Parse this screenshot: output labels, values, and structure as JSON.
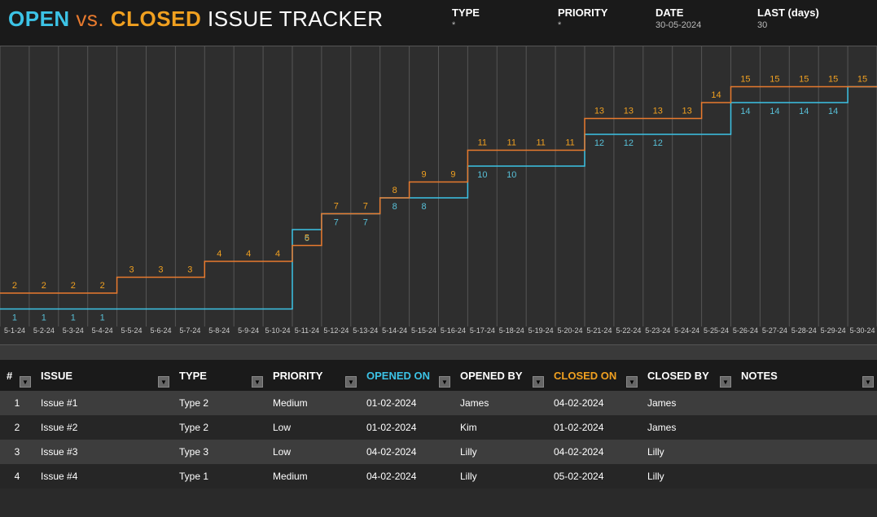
{
  "title": {
    "open": "OPEN",
    "vs": "vs.",
    "closed": "CLOSED",
    "rest": "ISSUE TRACKER"
  },
  "filters": {
    "type": {
      "label": "TYPE",
      "value": "*"
    },
    "prio": {
      "label": "PRIORITY",
      "value": "*"
    },
    "date": {
      "label": "DATE",
      "value": "30-05-2024"
    },
    "last": {
      "label": "LAST (days)",
      "value": "30"
    }
  },
  "columns": {
    "num": "#",
    "issue": "ISSUE",
    "type": "TYPE",
    "prio": "PRIORITY",
    "opened_on": "OPENED ON",
    "opened_by": "OPENED BY",
    "closed_on": "CLOSED ON",
    "closed_by": "CLOSED BY",
    "notes": "NOTES"
  },
  "rows": [
    {
      "num": "1",
      "issue": "Issue #1",
      "type": "Type 2",
      "prio": "Medium",
      "opened_on": "01-02-2024",
      "opened_by": "James",
      "closed_on": "04-02-2024",
      "closed_by": "James",
      "notes": ""
    },
    {
      "num": "2",
      "issue": "Issue #2",
      "type": "Type 2",
      "prio": "Low",
      "opened_on": "01-02-2024",
      "opened_by": "Kim",
      "closed_on": "01-02-2024",
      "closed_by": "James",
      "notes": ""
    },
    {
      "num": "3",
      "issue": "Issue #3",
      "type": "Type 3",
      "prio": "Low",
      "opened_on": "04-02-2024",
      "opened_by": "Lilly",
      "closed_on": "04-02-2024",
      "closed_by": "Lilly",
      "notes": ""
    },
    {
      "num": "4",
      "issue": "Issue #4",
      "type": "Type 1",
      "prio": "Medium",
      "opened_on": "04-02-2024",
      "opened_by": "Lilly",
      "closed_on": "05-02-2024",
      "closed_by": "Lilly",
      "notes": ""
    }
  ],
  "chart_data": {
    "type": "line",
    "title": "OPEN vs. CLOSED ISSUE TRACKER",
    "xlabel": "",
    "ylabel": "",
    "ylim": [
      0,
      16
    ],
    "categories": [
      "5-1-24",
      "5-2-24",
      "5-3-24",
      "5-4-24",
      "5-5-24",
      "5-6-24",
      "5-7-24",
      "5-8-24",
      "5-9-24",
      "5-10-24",
      "5-11-24",
      "5-12-24",
      "5-13-24",
      "5-14-24",
      "5-15-24",
      "5-16-24",
      "5-17-24",
      "5-18-24",
      "5-19-24",
      "5-20-24",
      "5-21-24",
      "5-22-24",
      "5-23-24",
      "5-24-24",
      "5-25-24",
      "5-26-24",
      "5-27-24",
      "5-28-24",
      "5-29-24",
      "5-30-24"
    ],
    "series": [
      {
        "name": "Open",
        "color": "#3cc3e6",
        "values": [
          1,
          1,
          1,
          1,
          null,
          null,
          null,
          null,
          null,
          null,
          6,
          7,
          7,
          8,
          8,
          null,
          10,
          10,
          null,
          null,
          12,
          12,
          12,
          null,
          null,
          14,
          14,
          14,
          14,
          null
        ]
      },
      {
        "name": "Closed",
        "color": "#e87a2e",
        "values": [
          2,
          2,
          2,
          2,
          3,
          3,
          3,
          4,
          4,
          4,
          5,
          7,
          7,
          8,
          9,
          9,
          11,
          11,
          11,
          11,
          13,
          13,
          13,
          13,
          14,
          15,
          15,
          15,
          15,
          15
        ]
      }
    ],
    "open_line_y": [
      1,
      1,
      1,
      1,
      1,
      1,
      1,
      1,
      1,
      1,
      6,
      7,
      7,
      8,
      8,
      8,
      10,
      10,
      10,
      10,
      12,
      12,
      12,
      12,
      12,
      14,
      14,
      14,
      14,
      15
    ],
    "closed_line_y": [
      2,
      2,
      2,
      2,
      3,
      3,
      3,
      4,
      4,
      4,
      5,
      7,
      7,
      8,
      9,
      9,
      11,
      11,
      11,
      11,
      13,
      13,
      13,
      13,
      14,
      15,
      15,
      15,
      15,
      15
    ]
  }
}
